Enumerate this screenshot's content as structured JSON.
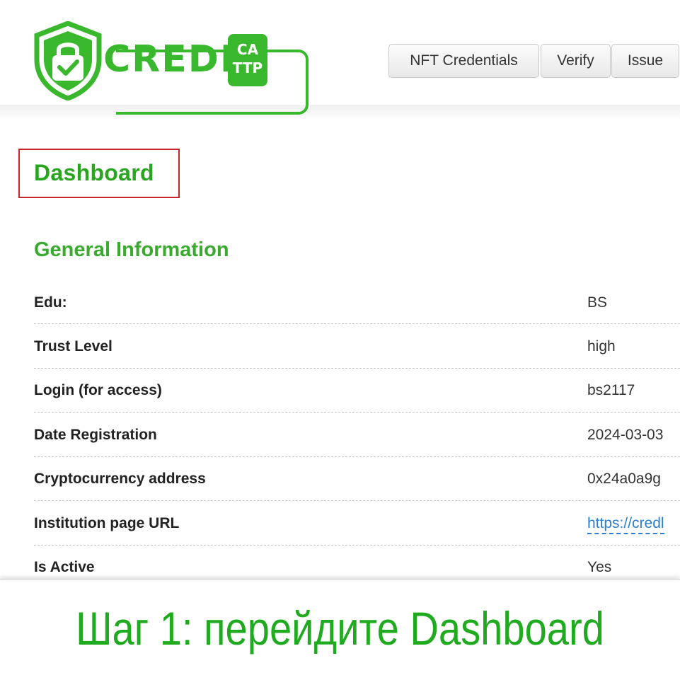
{
  "brand": {
    "wordmark": "CREDLY",
    "badge_line1": "CA",
    "badge_line2": "TTP",
    "logo_icon": "shield-lock-check-icon",
    "color": "#39b82e"
  },
  "nav": {
    "nft_credentials": "NFT Credentials",
    "verify": "Verify",
    "issue": "Issue"
  },
  "page": {
    "title": "Dashboard",
    "highlight_color": "#c8262b"
  },
  "general_info": {
    "heading": "General Information",
    "rows": [
      {
        "label": "Edu:",
        "value": "BS"
      },
      {
        "label": "Trust Level",
        "value": "high"
      },
      {
        "label": "Login (for access)",
        "value": "bs2117"
      },
      {
        "label": "Date Registration",
        "value": "2024-03-03"
      },
      {
        "label": "Cryptocurrency address",
        "value": "0x24a0a9g"
      },
      {
        "label": "Institution page URL",
        "value": "https://credl"
      },
      {
        "label": "Is Active",
        "value": "Yes"
      }
    ]
  },
  "caption": {
    "text": "Шаг 1: перейдите Dashboard",
    "color": "#1faa1f"
  }
}
